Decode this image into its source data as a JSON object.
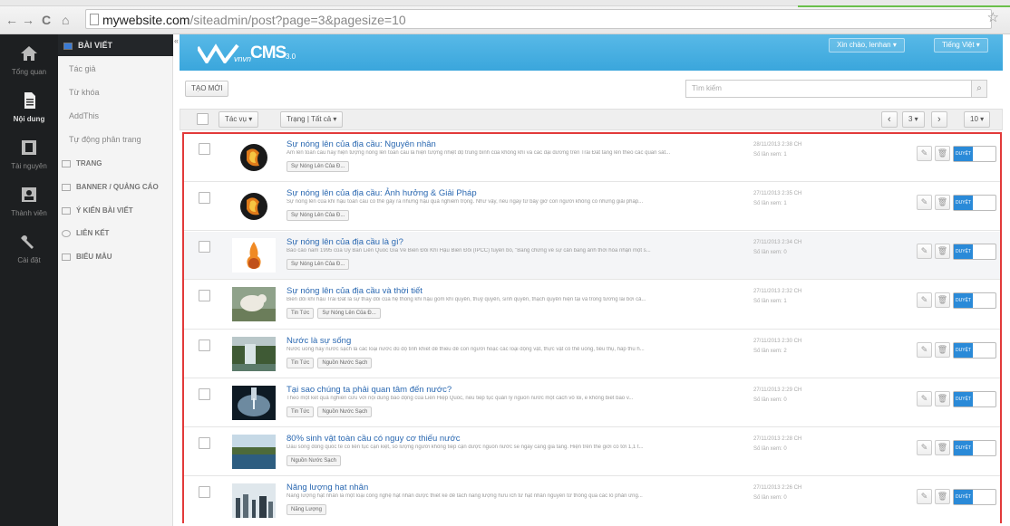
{
  "browser": {
    "back": "←",
    "forward": "→",
    "reload": "C",
    "home": "⌂",
    "url_host": "mywebsite.com",
    "url_path": "/siteadmin/post?page=3&pagesize=10",
    "star": "☆"
  },
  "sidebar": {
    "items": [
      {
        "label": "Tổng quan",
        "icon": "home-icon"
      },
      {
        "label": "Nội dung",
        "icon": "document-icon"
      },
      {
        "label": "Tài nguyên",
        "icon": "film-icon"
      },
      {
        "label": "Thành viên",
        "icon": "users-icon"
      },
      {
        "label": "Cài đặt",
        "icon": "wrench-icon"
      }
    ]
  },
  "submenu": {
    "items": [
      {
        "label": "BÀI VIẾT",
        "type": "head"
      },
      {
        "label": "Tác giả",
        "type": "item"
      },
      {
        "label": "Từ khóa",
        "type": "item"
      },
      {
        "label": "AddThis",
        "type": "item"
      },
      {
        "label": "Tự động phân trang",
        "type": "item"
      },
      {
        "label": "TRANG",
        "type": "section"
      },
      {
        "label": "BANNER / QUẢNG CÁO",
        "type": "section"
      },
      {
        "label": "Ý KIẾN BÀI VIẾT",
        "type": "section"
      },
      {
        "label": "LIÊN KẾT",
        "type": "section"
      },
      {
        "label": "BIỂU MẪU",
        "type": "section"
      }
    ],
    "collapse": "«"
  },
  "header": {
    "logo_prefix": "vnvn",
    "logo_text": "CMS",
    "logo_version": "3.0",
    "greeting": "Xin chào, lenhan ▾",
    "language": "Tiếng Việt ▾"
  },
  "toolbar": {
    "new_label": "TẠO MỚI",
    "search_placeholder": "Tìm kiếm",
    "search_icon": "⌕"
  },
  "filters": {
    "author": "Tác vụ ▾",
    "status": "Trạng | Tất cả ▾",
    "prev": "‹",
    "page": "3 ▾",
    "next": "›",
    "pagesize": "10 ▾"
  },
  "rows": [
    {
      "title": "Sự nóng lên của địa cầu: Nguyên nhân",
      "desc": "Ấm lên toàn cầu hay hiện tượng nóng lên toàn cầu là hiện tượng nhiệt độ trung bình của không khí và các đại dương trên Trái Đất tăng lên theo các quan sát...",
      "tags": [
        "Sự Nóng Lên Của Đ..."
      ],
      "date": "28/11/2013 2:38 CH",
      "views": "Số lần xem: 1",
      "thumb": "earth-fire"
    },
    {
      "title": "Sự nóng lên của địa cầu: Ảnh hưởng & Giải Pháp",
      "desc": "Sự nóng lên của khí hậu toàn cầu có thể gây ra những hậu quả nghiêm trọng. Như vậy, nếu ngay từ bây giờ con người không có những giải pháp...",
      "tags": [
        "Sự Nóng Lên Của Đ..."
      ],
      "date": "27/11/2013 2:35 CH",
      "views": "Số lần xem: 1",
      "thumb": "earth-fire"
    },
    {
      "title": "Sự nóng lên của địa cầu là gì?",
      "desc": "Báo cáo năm 1995 của Ủy Ban Liên Quốc Gia Về Biến Đổi Khí Hậu Biến Đổi (IPCC) tuyên bố, \"Bằng chứng về sự cân bằng ảnh thời hóa nhận một s...",
      "tags": [
        "Sự Nóng Lên Của Đ..."
      ],
      "date": "27/11/2013 2:34 CH",
      "views": "Số lần xem: 0",
      "thumb": "flame"
    },
    {
      "title": "Sự nóng lên của địa cầu và thời tiết",
      "desc": "Biến đổi khí hậu Trái Đất là sự thay đổi của hệ thống khí hậu gồm khí quyển, thuỷ quyển, sinh quyển, thạch quyển hiện tại và trong tương lai bởi cả...",
      "tags": [
        "Tin Tức",
        "Sự Nóng Lên Của Đ..."
      ],
      "date": "27/11/2013 2:32 CH",
      "views": "Số lần xem: 1",
      "thumb": "bear"
    },
    {
      "title": "Nước là sự sống",
      "desc": "Nước uống hay nước sạch là các loại nước đủ độ tinh khiết để thiếu để con người hoặc các loại động vật, thực vật có thể uống, tiêu thụ, hấp thu h...",
      "tags": [
        "Tin Tức",
        "Nguồn Nước Sạch"
      ],
      "date": "27/11/2013 2:30 CH",
      "views": "Số lần xem: 2",
      "thumb": "waterfall"
    },
    {
      "title": "Tại sao chúng ta phải quan tâm đến nước?",
      "desc": "Theo một kết quả nghiên cứu với nội dung báo động của Liên Hiệp Quốc, nếu tiếp tục quản lý nguồn nước một cách vô lối, e không biết bao v...",
      "tags": [
        "Tin Tức",
        "Nguồn Nước Sạch"
      ],
      "date": "27/11/2013 2:29 CH",
      "views": "Số lần xem: 0",
      "thumb": "tap"
    },
    {
      "title": "80% sinh vật toàn cầu có nguy cơ thiếu nước",
      "desc": "Dấu sông đồng quốc tế có liên tục cạn kiệt, số lượng người không tiếp cận được nguồn nước sẽ ngày càng gia tăng. Hiện trên thế giới có tới 1,1 t...",
      "tags": [
        "Nguồn Nước Sạch"
      ],
      "date": "27/11/2013 2:28 CH",
      "views": "Số lần xem: 0",
      "thumb": "lake"
    },
    {
      "title": "Năng lượng hạt nhân",
      "desc": "Năng lượng hạt nhân là một loại công nghệ hạt nhân được thiết kế để tách năng lượng hữu ích từ hạt nhân nguyên tử thông qua các lò phản ứng...",
      "tags": [
        "Năng Lượng"
      ],
      "date": "27/11/2013 2:26 CH",
      "views": "Số lần xem: 0",
      "thumb": "plant"
    }
  ],
  "row_actions": {
    "edit_icon": "✎",
    "delete_icon": "🗑",
    "toggle_label": "DUYỆT"
  },
  "colors": {
    "banner": "#3aa6dc",
    "link": "#2a68b1",
    "highlight_border": "#e23a3a",
    "toggle_on": "#2a8ad8"
  }
}
